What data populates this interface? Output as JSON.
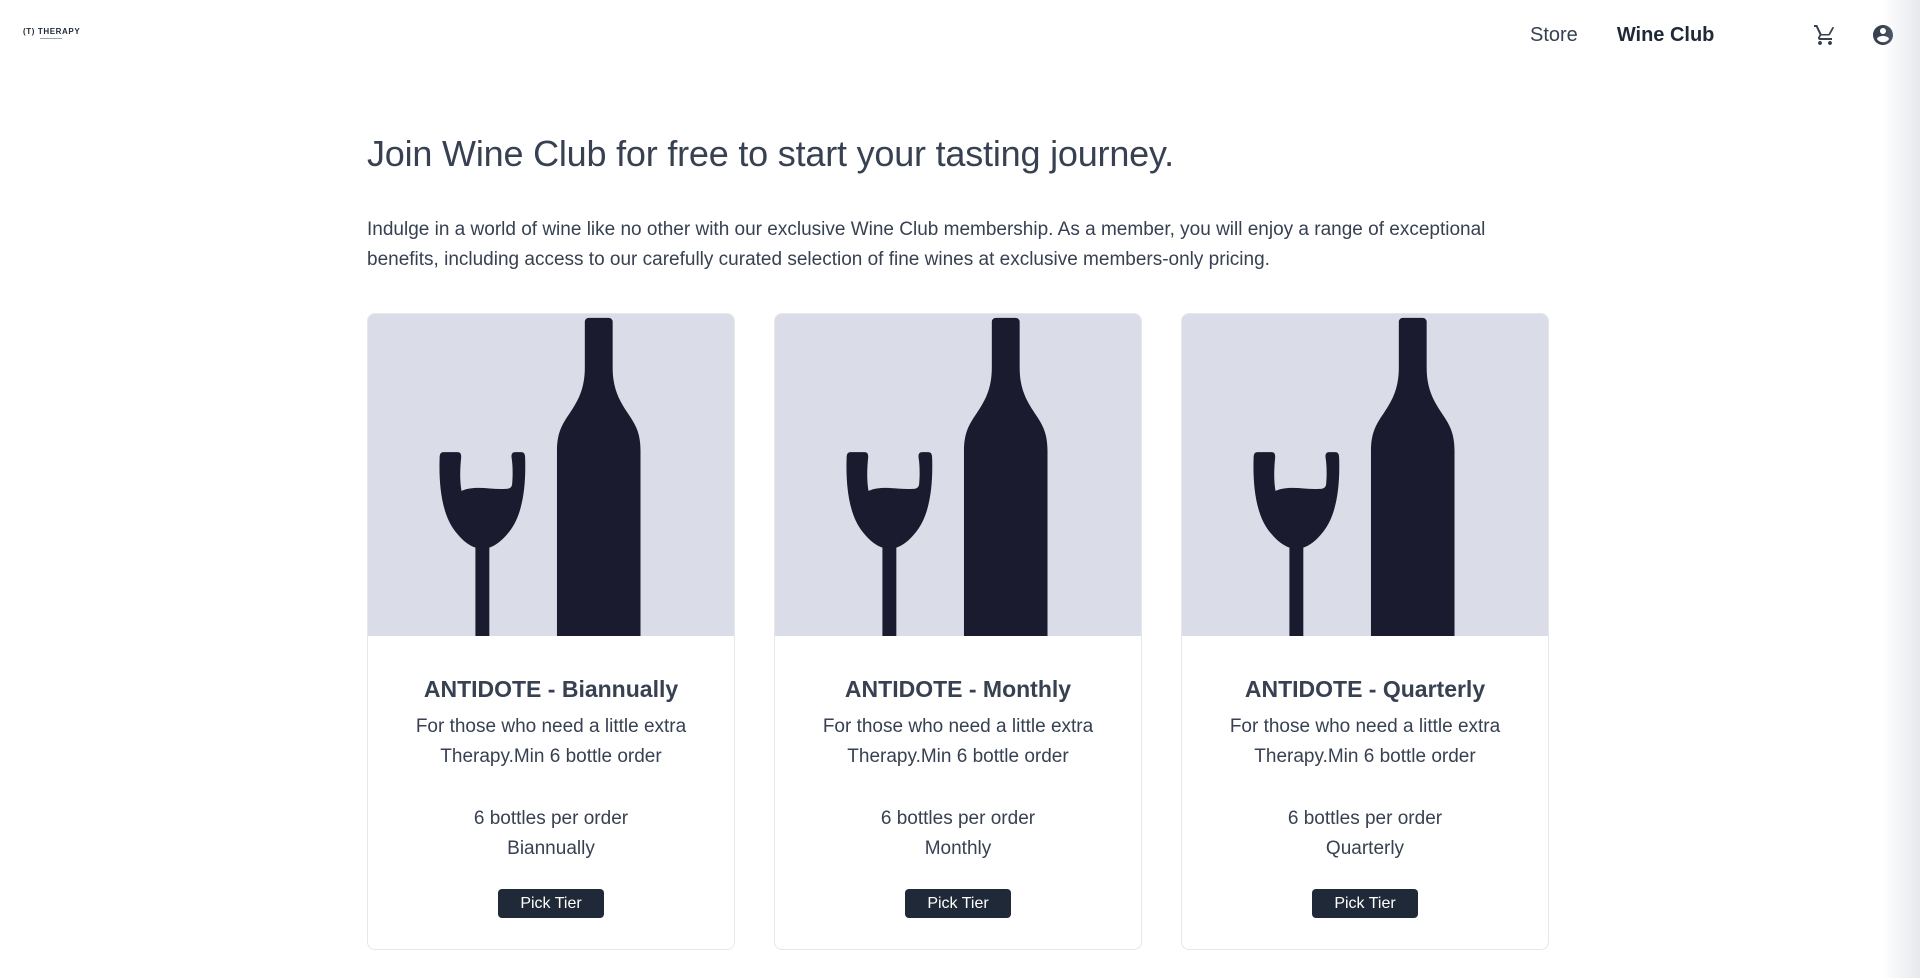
{
  "header": {
    "logo_text": "(T) THERAPY",
    "nav": [
      {
        "label": "Store",
        "active": false
      },
      {
        "label": "Wine Club",
        "active": true
      }
    ],
    "icons": [
      "cart-icon",
      "account-icon"
    ]
  },
  "main": {
    "headline": "Join Wine Club for free to start your tasting journey.",
    "intro": "Indulge in a world of wine like no other with our exclusive Wine Club membership. As a member, you will enjoy a range of exceptional benefits, including access to our carefully curated selection of fine wines at exclusive members-only pricing.",
    "tiers": [
      {
        "title": "ANTIDOTE - Biannually",
        "description": "For those who need a little extra Therapy.Min 6 bottle order",
        "bottles": "6 bottles per order",
        "frequency": "Biannually",
        "button": "Pick Tier",
        "image_icon": "wine-glass-bottle-icon"
      },
      {
        "title": "ANTIDOTE - Monthly",
        "description": "For those who need a little extra Therapy.Min 6 bottle order",
        "bottles": "6 bottles per order",
        "frequency": "Monthly",
        "button": "Pick Tier",
        "image_icon": "wine-glass-bottle-icon"
      },
      {
        "title": "ANTIDOTE - Quarterly",
        "description": "For those who need a little extra Therapy.Min 6 bottle order",
        "bottles": "6 bottles per order",
        "frequency": "Quarterly",
        "button": "Pick Tier",
        "image_icon": "wine-glass-bottle-icon"
      }
    ]
  },
  "colors": {
    "image_background": "#dadde8",
    "illustration": "#1a1b2e",
    "button_background": "#1f2937",
    "text": "#374151"
  }
}
